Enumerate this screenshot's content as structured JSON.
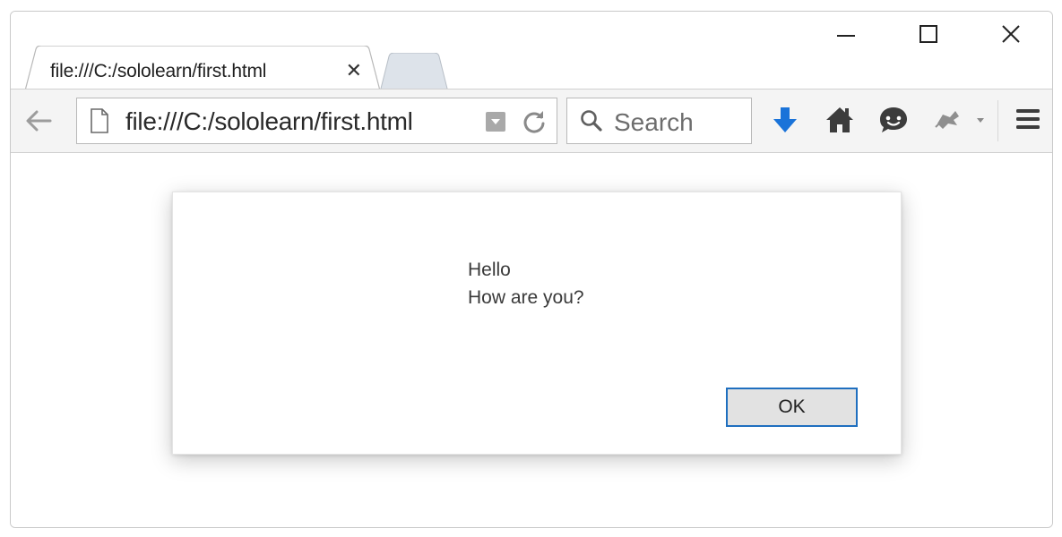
{
  "window": {
    "controls": [
      "minimize",
      "maximize",
      "close"
    ]
  },
  "tab": {
    "title": "file:///C:/sololearn/first.html",
    "close_glyph": "✕"
  },
  "toolbar": {
    "url": "file:///C:/sololearn/first.html",
    "search_placeholder": "Search",
    "icons": [
      "back-arrow-icon",
      "page-icon",
      "reader-view-icon",
      "reload-icon",
      "search-icon",
      "download-icon",
      "home-icon",
      "chat-icon",
      "extension-icon",
      "menu-icon"
    ],
    "accent": "#1a73d9"
  },
  "dialog": {
    "line1": "Hello",
    "line2": "How are you?",
    "ok_label": "OK",
    "button_border_color": "#1f6fbf"
  }
}
